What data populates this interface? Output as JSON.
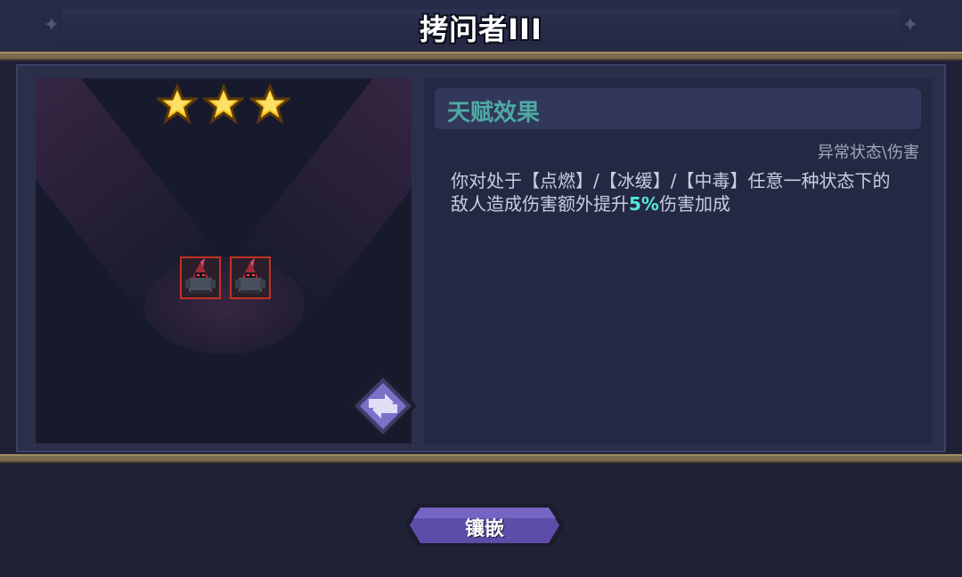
{
  "header": {
    "title": "拷问者III"
  },
  "showcase": {
    "star_count": 3,
    "star_max": 3,
    "unit_count": 2,
    "swap_icon": "swap-arrows-icon"
  },
  "talent": {
    "section_title": "天赋效果",
    "category": "异常状态\\伤害",
    "description_before": "你对处于【点燃】/【冰缓】/【中毒】任意一种状态下的敌人造成伤害额外提升",
    "description_highlight": "5%",
    "description_after": "伤害加成"
  },
  "actions": {
    "embed_label": "镶嵌"
  },
  "colors": {
    "accent_teal": "#56e6dd",
    "title_teal": "#4fa9a4",
    "button_purple": "#5d4ca8",
    "unit_border": "#c3321f",
    "star_gold": "#f7c21b"
  }
}
